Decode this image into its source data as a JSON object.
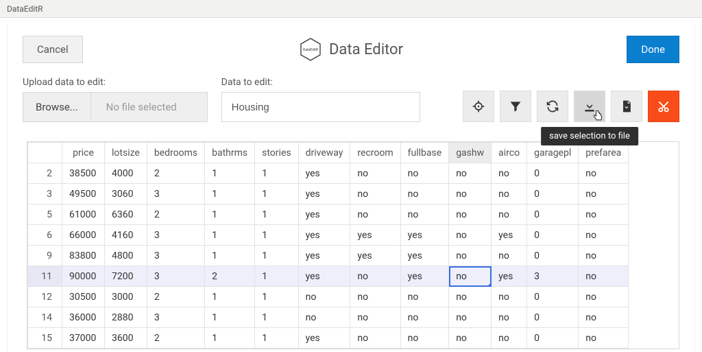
{
  "window_title": "DataEditR",
  "header": {
    "cancel_label": "Cancel",
    "brand_label": "Data Editor",
    "done_label": "Done"
  },
  "upload": {
    "label": "Upload data to edit:",
    "browse_label": "Browse...",
    "file_status": "No file selected"
  },
  "dataset": {
    "label": "Data to edit:",
    "value": "Housing"
  },
  "toolbar": {
    "crosshair_name": "select-rows-columns",
    "filter_name": "filter",
    "sync_name": "sync",
    "download_sel_name": "save-selection-to-file",
    "download_name": "save-to-file",
    "cut_name": "cut",
    "tooltip_download_sel": "save selection to file"
  },
  "table": {
    "columns": [
      "price",
      "lotsize",
      "bedrooms",
      "bathrms",
      "stories",
      "driveway",
      "recroom",
      "fullbase",
      "gashw",
      "airco",
      "garagepl",
      "prefarea"
    ],
    "sorted_column": "gashw",
    "highlighted_row_index": 5,
    "selected_cell": {
      "row_index": 5,
      "col_index": 8
    },
    "rows": [
      {
        "n": 2,
        "values": [
          "38500",
          "4000",
          "2",
          "1",
          "1",
          "yes",
          "no",
          "no",
          "no",
          "no",
          "0",
          "no"
        ]
      },
      {
        "n": 3,
        "values": [
          "49500",
          "3060",
          "3",
          "1",
          "1",
          "yes",
          "no",
          "no",
          "no",
          "no",
          "0",
          "no"
        ]
      },
      {
        "n": 5,
        "values": [
          "61000",
          "6360",
          "2",
          "1",
          "1",
          "yes",
          "no",
          "no",
          "no",
          "no",
          "0",
          "no"
        ]
      },
      {
        "n": 6,
        "values": [
          "66000",
          "4160",
          "3",
          "1",
          "1",
          "yes",
          "yes",
          "yes",
          "no",
          "yes",
          "0",
          "no"
        ]
      },
      {
        "n": 9,
        "values": [
          "83800",
          "4800",
          "3",
          "1",
          "1",
          "yes",
          "yes",
          "yes",
          "no",
          "no",
          "0",
          "no"
        ]
      },
      {
        "n": 11,
        "values": [
          "90000",
          "7200",
          "3",
          "2",
          "1",
          "yes",
          "no",
          "yes",
          "no",
          "yes",
          "3",
          "no"
        ]
      },
      {
        "n": 12,
        "values": [
          "30500",
          "3000",
          "2",
          "1",
          "1",
          "no",
          "no",
          "no",
          "no",
          "no",
          "0",
          "no"
        ]
      },
      {
        "n": 14,
        "values": [
          "36000",
          "2880",
          "3",
          "1",
          "1",
          "no",
          "no",
          "no",
          "no",
          "no",
          "0",
          "no"
        ]
      },
      {
        "n": 15,
        "values": [
          "37000",
          "3600",
          "2",
          "1",
          "1",
          "yes",
          "no",
          "no",
          "no",
          "no",
          "0",
          "no"
        ]
      }
    ]
  }
}
